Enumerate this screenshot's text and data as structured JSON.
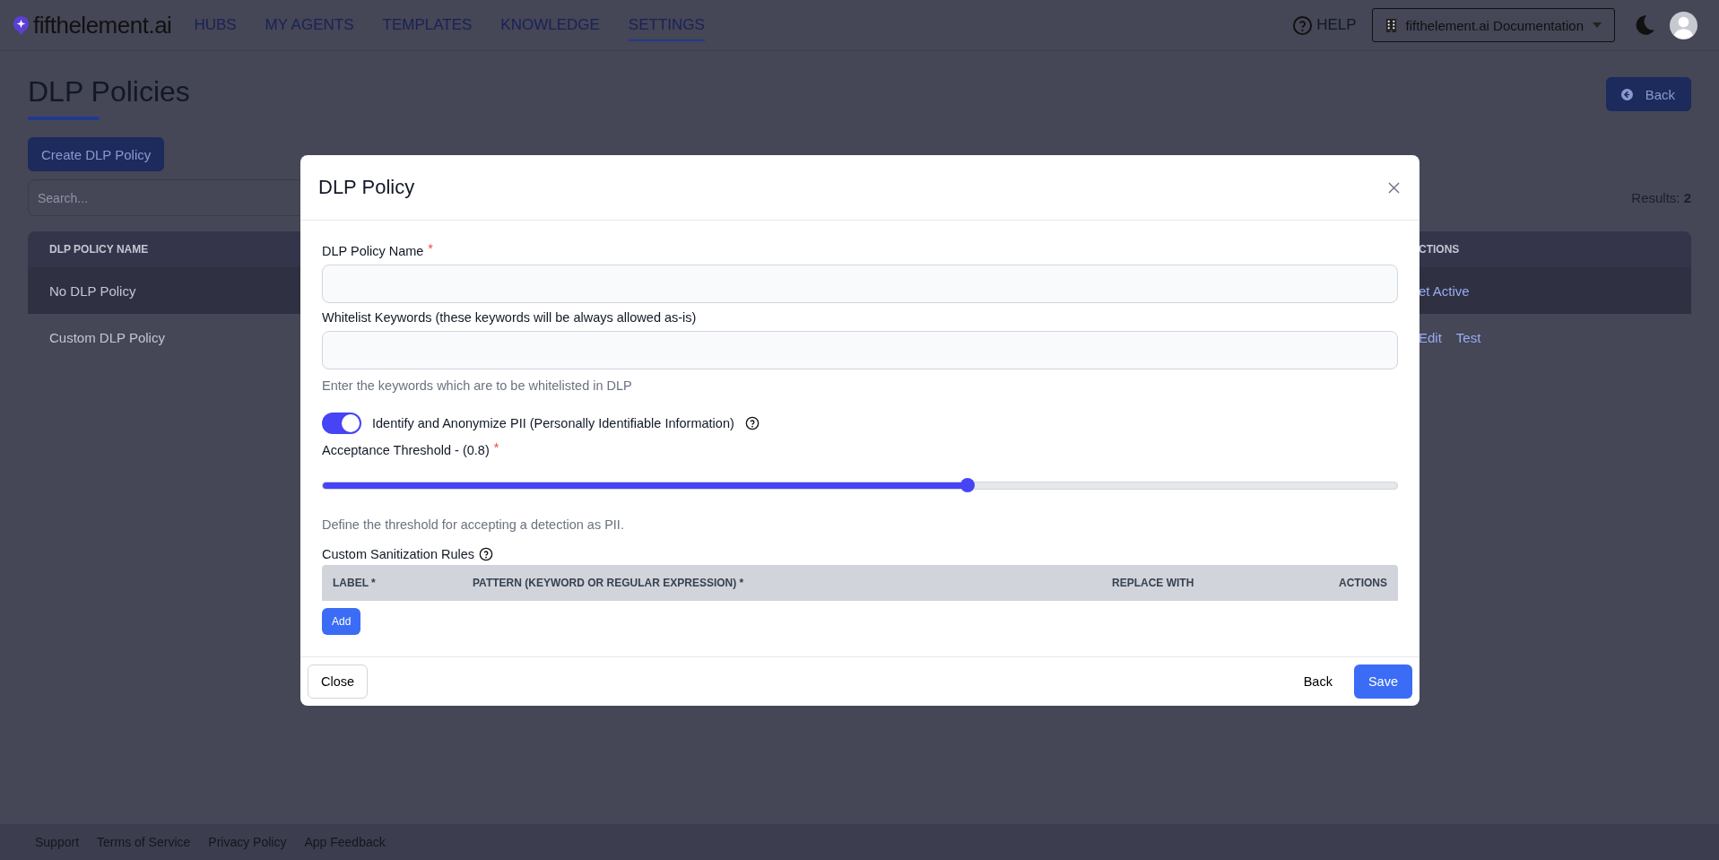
{
  "header": {
    "logo": "fifthelement.ai",
    "nav": [
      {
        "label": "HUBS",
        "selected": false
      },
      {
        "label": "MY AGENTS",
        "selected": false
      },
      {
        "label": "TEMPLATES",
        "selected": false
      },
      {
        "label": "KNOWLEDGE",
        "selected": false
      },
      {
        "label": "SETTINGS",
        "selected": true
      }
    ],
    "help": "HELP",
    "workspace": "fifthelement.ai Documentation"
  },
  "page": {
    "title": "DLP Policies",
    "back_button": "Back",
    "create_button": "Create DLP Policy",
    "search": {
      "placeholder": "Search..."
    },
    "results_label": "Results:",
    "results_count": "2",
    "table": {
      "columns": [
        "DLP POLICY NAME",
        "CTIONS"
      ],
      "rows": [
        {
          "name": "No DLP Policy",
          "selected": true,
          "actions": [
            "et Active"
          ]
        },
        {
          "name": "Custom DLP Policy",
          "selected": false,
          "actions": [
            "Edit",
            "Test"
          ]
        }
      ]
    }
  },
  "modal": {
    "title": "DLP Policy",
    "name_label": "DLP Policy Name",
    "name_required": "*",
    "whitelist_label": "Whitelist Keywords (these keywords will be always allowed as-is)",
    "whitelist_hint": "Enter the keywords which are to be whitelisted in DLP",
    "pii_toggle": {
      "label": "Identify and Anonymize PII (Personally Identifiable Information)",
      "on": true
    },
    "threshold": {
      "label": "Acceptance Threshold - (0.8)",
      "required": "*",
      "level": 0.6,
      "hint": "Define the threshold for accepting a detection as PII."
    },
    "rules": {
      "title": "Custom Sanitization Rules",
      "columns": [
        "LABEL *",
        "PATTERN (KEYWORD OR REGULAR EXPRESSION) *",
        "REPLACE WITH",
        "ACTIONS"
      ],
      "add_button": "Add"
    },
    "close_button": "Close",
    "back_button": "Back",
    "save_button": "Save"
  },
  "footer": [
    "Support",
    "Terms of Service",
    "Privacy Policy",
    "App Feedback"
  ]
}
